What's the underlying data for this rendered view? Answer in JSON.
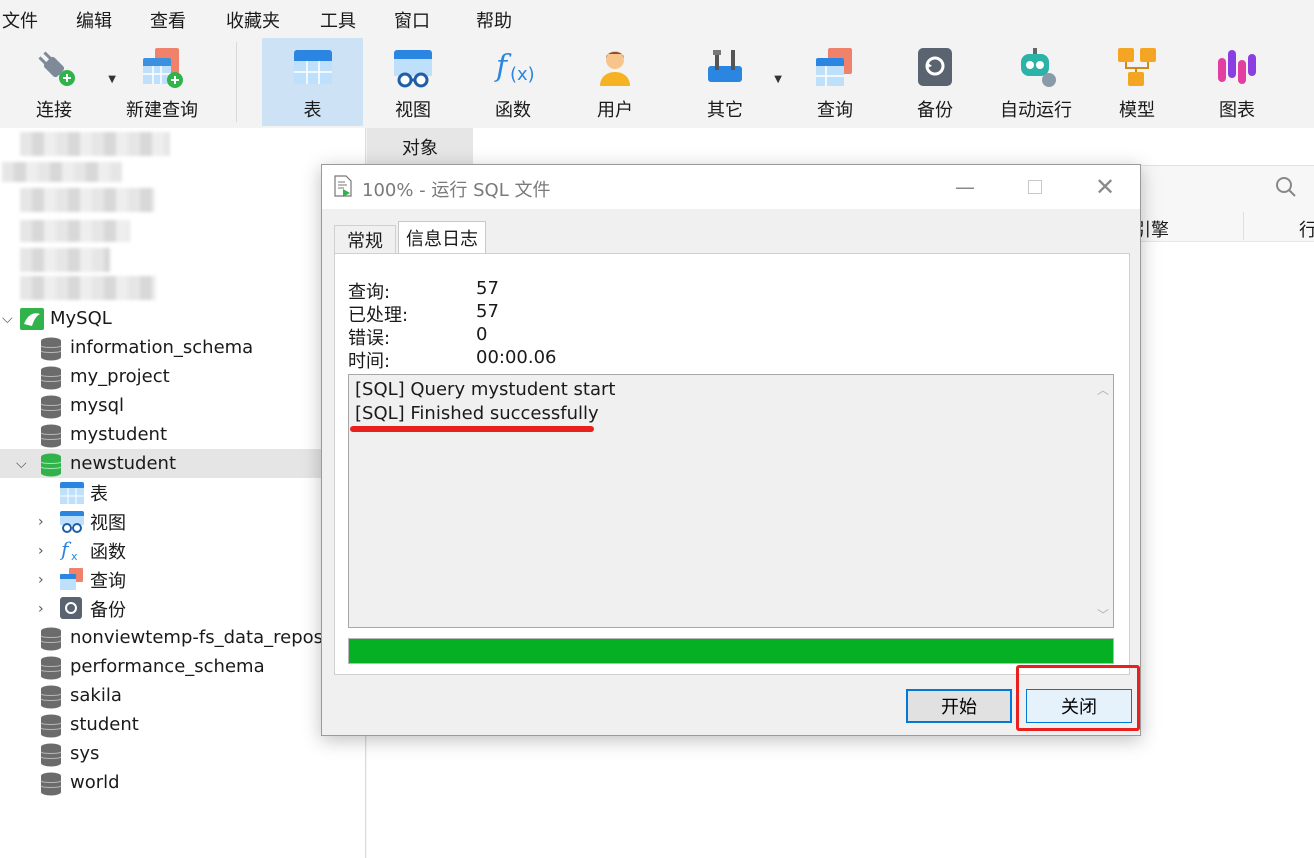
{
  "menu": [
    "文件",
    "编辑",
    "查看",
    "收藏夹",
    "工具",
    "窗口",
    "帮助"
  ],
  "toolbar": {
    "connect": "连接",
    "new_query": "新建查询",
    "table": "表",
    "view": "视图",
    "function": "函数",
    "user": "用户",
    "other": "其它",
    "query": "查询",
    "backup": "备份",
    "auto_run": "自动运行",
    "model": "模型",
    "chart": "图表"
  },
  "tree": {
    "connection": "MySQL",
    "databases": [
      "information_schema",
      "my_project",
      "mysql",
      "mystudent",
      "newstudent",
      "nonviewtemp-fs_data_reposit",
      "performance_schema",
      "sakila",
      "student",
      "sys",
      "world"
    ],
    "selected_db": "newstudent",
    "children": [
      "表",
      "视图",
      "函数",
      "查询",
      "备份"
    ]
  },
  "right": {
    "object_tab": "对象",
    "engine_col": "引擎",
    "col_partial": "行"
  },
  "dialog": {
    "title": "100% - 运行 SQL 文件",
    "tabs": [
      "常规",
      "信息日志"
    ],
    "stats": [
      {
        "label": "查询:",
        "value": "57"
      },
      {
        "label": "已处理:",
        "value": "57"
      },
      {
        "label": "错误:",
        "value": "0"
      },
      {
        "label": "时间:",
        "value": "00:00.06"
      }
    ],
    "log": [
      "[SQL] Query mystudent start",
      "[SQL] Finished successfully"
    ],
    "progress": 1.0,
    "start_btn": "开始",
    "close_btn": "关闭"
  },
  "colors": {
    "progress": "#06b025",
    "highlight": "#e8201e",
    "toolbar_active": "#cde3f5"
  }
}
